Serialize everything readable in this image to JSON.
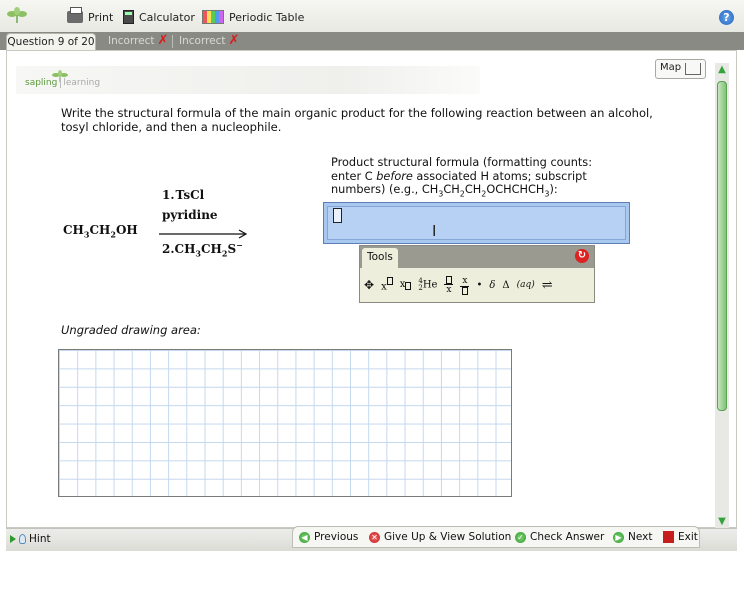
{
  "toolbar": {
    "print_label": "Print",
    "calculator_label": "Calculator",
    "periodic_table_label": "Periodic Table",
    "help_symbol": "?"
  },
  "tabs": {
    "current": "Question 9 of 20",
    "attempts": [
      "Incorrect",
      "Incorrect"
    ],
    "attempt_mark": "✗"
  },
  "header": {
    "logo_primary": "sapling",
    "logo_secondary": "learning",
    "map_label": "Map"
  },
  "question": {
    "text": "Write the structural formula of the main organic product for the following reaction between an alcohol, tosyl chloride, and then a nucleophile."
  },
  "reaction": {
    "reactant": "CH3CH2OH",
    "step1": "1. TsCl",
    "step1_reagent": "pyridine",
    "step2": "2. CH3CH2S−"
  },
  "answer": {
    "instructions_line1": "Product structural formula (formatting counts:",
    "instructions_before": "enter C ",
    "instructions_em": "before",
    "instructions_after": " associated H atoms; subscript",
    "instructions_line3": "numbers) (e.g., CH3CH2CH2OCHCHCH3):",
    "value": ""
  },
  "tools": {
    "label": "Tools",
    "items": [
      "move",
      "superscript",
      "subscript",
      "isotope",
      "fraction",
      "over",
      "dot",
      "delta-lower",
      "delta-upper",
      "aq",
      "equilibrium"
    ]
  },
  "drawing": {
    "label": "Ungraded drawing area:"
  },
  "bottom": {
    "hint_label": "Hint",
    "previous_label": "Previous",
    "give_up_label": "Give Up & View Solution",
    "check_label": "Check Answer",
    "next_label": "Next",
    "exit_label": "Exit"
  },
  "colors": {
    "answer_fill": "#a9c8f0",
    "tab_bar": "#8a8a85",
    "grid_line": "#c4d8ee",
    "incorrect_mark": "#d91b1b",
    "accent_green": "#2f9a2a"
  }
}
